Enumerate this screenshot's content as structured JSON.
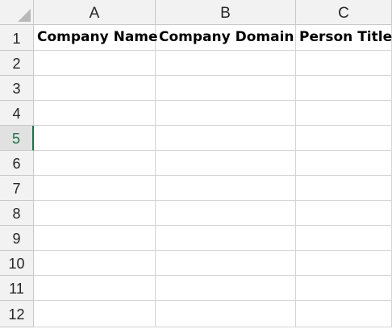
{
  "columns": [
    {
      "label": "A"
    },
    {
      "label": "B"
    },
    {
      "label": "C"
    }
  ],
  "rows": [
    "1",
    "2",
    "3",
    "4",
    "5",
    "6",
    "7",
    "8",
    "9",
    "10",
    "11",
    "12"
  ],
  "active_row": "5",
  "header_cells": {
    "A1": "Company Name",
    "B1": "Company Domain",
    "C1": "Person Title"
  },
  "colors": {
    "header_bg": "#f2f2f2",
    "gridline": "#d4d4d4",
    "active_accent": "#217346"
  },
  "icons": {
    "corner": "select-all-triangle-icon"
  }
}
